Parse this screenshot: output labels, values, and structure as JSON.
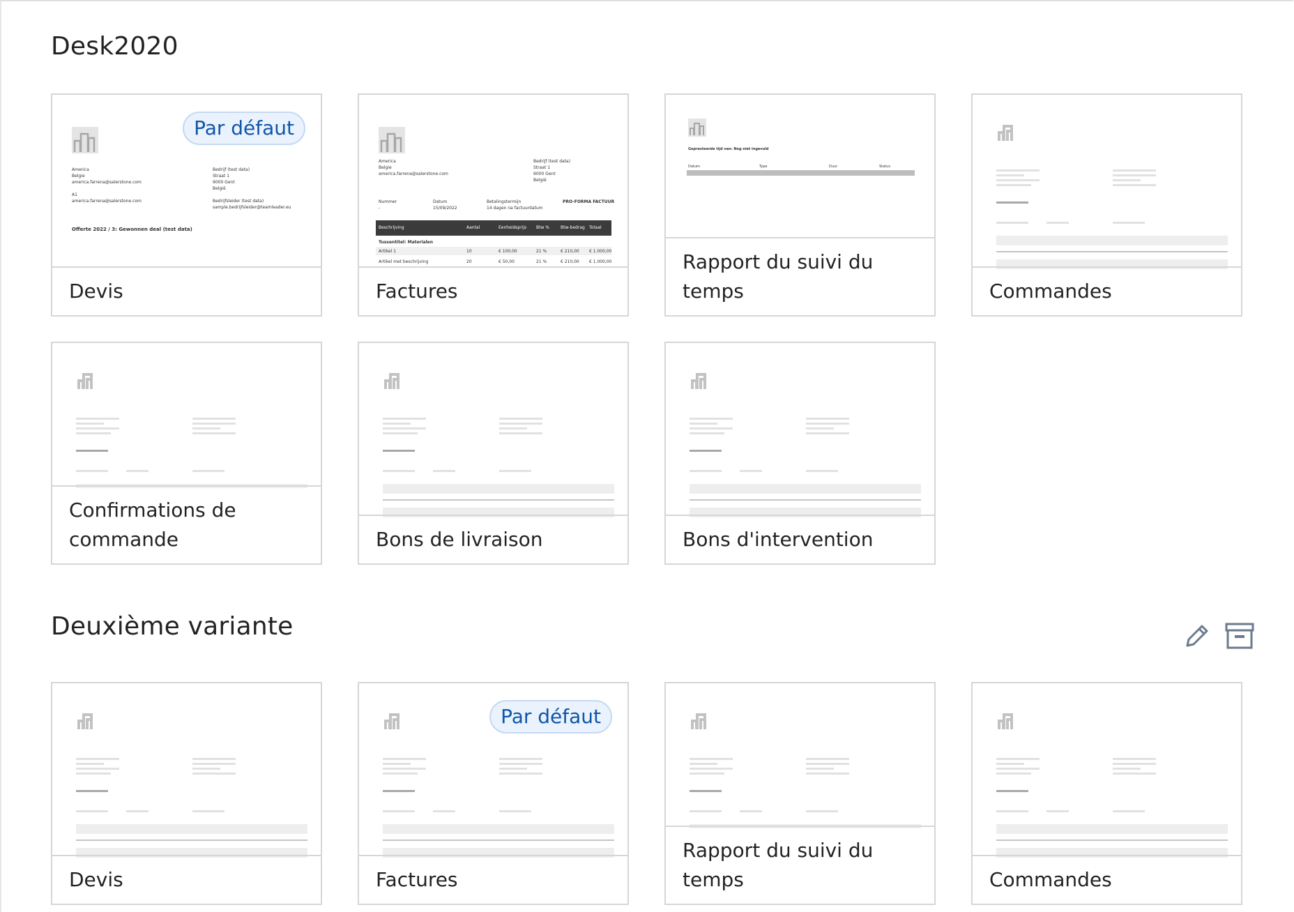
{
  "sections": [
    {
      "title": "Desk2020",
      "cards": [
        {
          "label": "Devis",
          "badge": "Par défaut"
        },
        {
          "label": "Factures"
        },
        {
          "label": "Rapport du suivi du temps"
        },
        {
          "label": "Commandes"
        },
        {
          "label": "Confirmations de commande"
        },
        {
          "label": "Bons de livraison"
        },
        {
          "label": "Bons d'intervention"
        }
      ]
    },
    {
      "title": "Deuxième variante",
      "actions": [
        {
          "icon": "pencil-icon"
        },
        {
          "icon": "archive-icon"
        }
      ],
      "cards": [
        {
          "label": "Devis"
        },
        {
          "label": "Factures",
          "badge": "Par défaut"
        },
        {
          "label": "Rapport du suivi du temps"
        },
        {
          "label": "Commandes"
        }
      ]
    }
  ],
  "previews": {
    "devis": {
      "left_block": [
        "America",
        "Belgie",
        "america.farrena@salerstone.com",
        "A1",
        "america.farrena@salerstone.com"
      ],
      "right_block": [
        "Bedrijf (test data)",
        "Straat 1",
        "9000 Gent",
        "België",
        "Bedrijfsleider (test data)",
        "sample.bedrijfsleider@teamleader.eu"
      ],
      "heading": "Offerte 2022 / 3: Gewonnen deal (test data)"
    },
    "factures": {
      "left_block": [
        "America",
        "Belgie",
        "america.farrena@salerstone.com"
      ],
      "right_block": [
        "Bedrijf (test data)",
        "Straat 1",
        "9000 Gent",
        "België"
      ],
      "meta_labels": [
        "Nummer",
        "Datum",
        "Betalingstermijn"
      ],
      "meta_values": [
        "-",
        "15/09/2022",
        "14 dagen na factuurdatum"
      ],
      "doc_title": "PRO-FORMA FACTUUR",
      "table_header": [
        "Beschrijving",
        "Aantal",
        "Eenheidsprijs",
        "Btw %",
        "Btw-bedrag",
        "Totaal"
      ],
      "group": "Tussentitel: Materialen",
      "rows": [
        [
          "Artikel 1",
          "10",
          "€ 100,00",
          "21 %",
          "€ 210,00",
          "€ 1.000,00"
        ],
        [
          "Artikel met beschrijving",
          "20",
          "€ 50,00",
          "21 %",
          "€ 210,00",
          "€ 1.000,00"
        ]
      ]
    },
    "rapport": {
      "heading": "Gepresteerde tijd van: Nog niet ingevuld",
      "columns": [
        "Datum",
        "Type",
        "Duur",
        "Status"
      ]
    }
  }
}
